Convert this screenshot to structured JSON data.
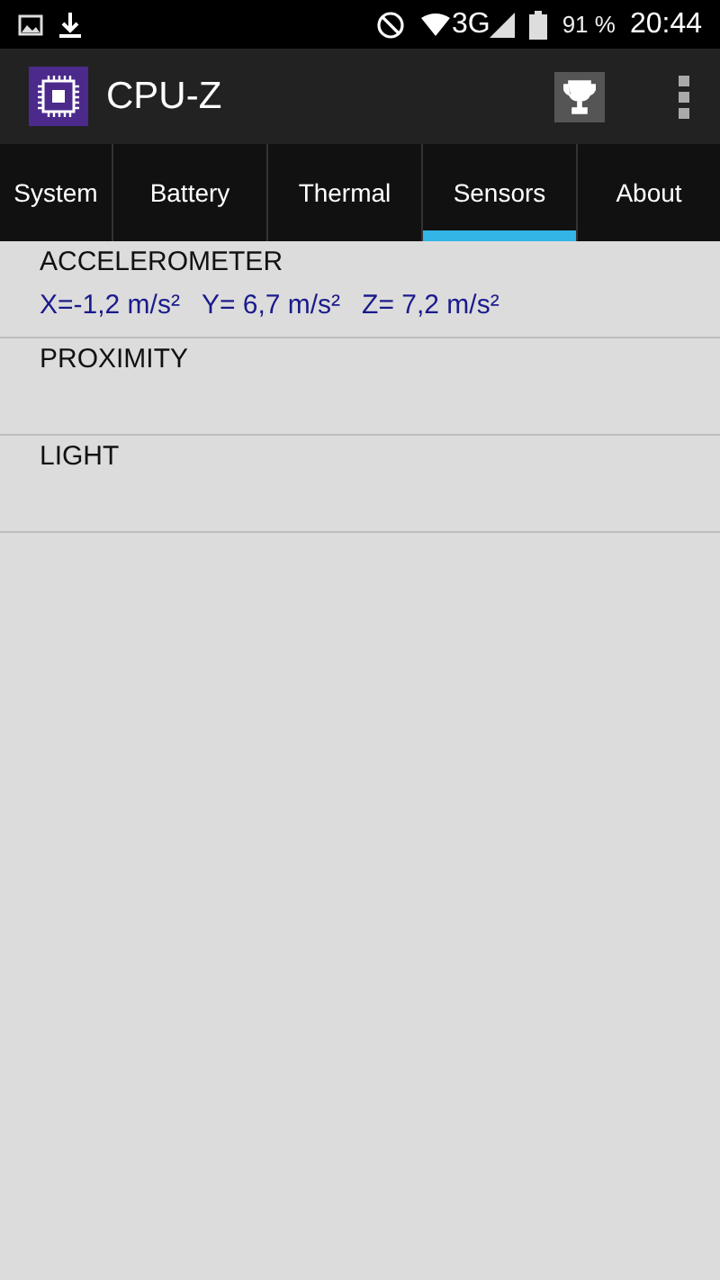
{
  "status_bar": {
    "battery": "91 %",
    "network": "3G",
    "time": "20:44"
  },
  "app_bar": {
    "title": "CPU-Z"
  },
  "tabs": [
    {
      "label": "System",
      "selected": false
    },
    {
      "label": "Battery",
      "selected": false
    },
    {
      "label": "Thermal",
      "selected": false
    },
    {
      "label": "Sensors",
      "selected": true
    },
    {
      "label": "About",
      "selected": false
    }
  ],
  "sensors": [
    {
      "name": "ACCELEROMETER",
      "values": [
        "X=-1,2 m/s²",
        "Y= 6,7 m/s²",
        "Z= 7,2 m/s²"
      ]
    },
    {
      "name": "PROXIMITY"
    },
    {
      "name": "LIGHT"
    }
  ]
}
